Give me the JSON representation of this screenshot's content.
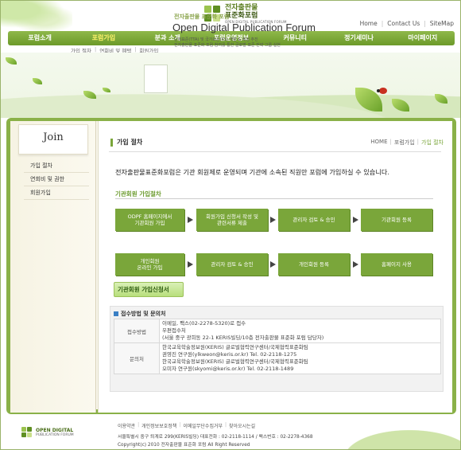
{
  "header": {
    "logo_kr_line1": "전자출판물",
    "logo_kr_line2": "표준화포럼",
    "logo_en": "OPEN DIGITAL PUBLICATION FORUM",
    "top_links": [
      "Home",
      "Contact Us",
      "SiteMap"
    ]
  },
  "nav": {
    "items": [
      "포럼소개",
      "포럼가입",
      "분과 소개",
      "포럼운영정보",
      "커뮤니티",
      "정기세미나",
      "마이페이지"
    ],
    "active_index": 1,
    "sub_items": [
      "가입 절차",
      "연회비 및 혜택",
      "회원가입"
    ]
  },
  "banner": {
    "kr_title": "전자출판물 표준화 포럼",
    "title": "Open Digital Publication Forum",
    "desc1": "단체표준(TTA) 및 국가표준(KS) 개발 & 제정 추진",
    "desc2": "전자출판물 표준화 포럼 참여를 통한 글로벌 표준 전략 그룹 실현"
  },
  "sidebar": {
    "join_title": "Join",
    "items": [
      "가입 절차",
      "연회비 및 권한",
      "회원가입"
    ]
  },
  "main": {
    "page_title": "가입 절차",
    "breadcrumb": [
      "HOME",
      "포럼가입",
      "가입 절차"
    ],
    "intro": "전자출판물표준화포럼은 기관 회원제로 운영되며 기관에 소속된 직원만 포럼에 가입하실 수 있습니다.",
    "section1_title": "기관회원 가입절차",
    "flow_row1": [
      "ODPF 홈페이지에서\n기관회원 가입",
      "회원가입 신청서 작성 및\n관련서류 제출",
      "관리자 검토 & 승인",
      "기관회원 등록"
    ],
    "flow_row2": [
      "개인회원\n온라인 가입",
      "관리자 검토 & 승인",
      "개인회원 등록",
      "홈페이지 사용"
    ],
    "apply_button": "기관회원 가입신청서",
    "contact_title": "접수방법 및 문의처",
    "contact_rows": [
      {
        "header": "접수방법",
        "lines": [
          "이메일, 팩스(02-2278-5320)로 접수",
          "우편접수처",
          "(서울 중구 광희동 22-1 KERIS빌딩/10층 전자출판물 표준화 포럼 담당자)"
        ]
      },
      {
        "header": "문의처",
        "lines": [
          "한국교육학술정보원(KERIS) 글로벌협력연구센터/국제협력표준화팀",
          "권영진 연구원(ylkweon@keris.or.kr) Tel. 02-2118-1275",
          "한국교육학술정보원(KERIS) 글로벌협력연구센터/국제협력표준화팀",
          "오미자 연구원(skyomi@keris.or.kr) Tel. 02-2118-1489"
        ]
      }
    ]
  },
  "footer": {
    "logo_line1": "OPEN DIGITAL",
    "logo_line2": "PUBLICATION FORUM",
    "links": [
      "이용약관",
      "개인정보보호정책",
      "이메일무단수집거부",
      "찾아오시는길"
    ],
    "address": "서울특별시 중구 퇴계로 299(KERIS빌딩) 대표전화 : 02-2118-1114 / 팩스번호 : 02-2278-4368",
    "copyright": "Copyright(c) 2010 전자출판물 표준화 포럼  All Right Reserved"
  },
  "colors": {
    "brand_green": "#7aa63a",
    "nav_active": "#fff36b",
    "frame": "#8ab148"
  }
}
